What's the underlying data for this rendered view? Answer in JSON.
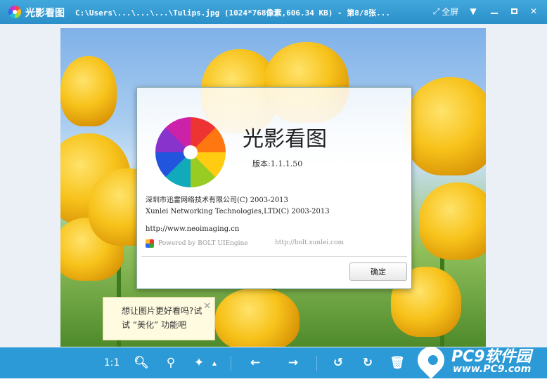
{
  "titlebar": {
    "app_name": "光影看图",
    "file_title": "C:\\Users\\...\\...\\...\\Tulips.jpg (1024*768像素,606.34 KB) - 第8/8张...",
    "fullscreen_label": "全屏"
  },
  "about": {
    "title": "光影看图",
    "version": "版本:1.1.1.50",
    "company_cn": "深圳市迅雷网络技术有限公司(C) 2003-2013",
    "company_en": "Xunlei Networking Technologies,LTD(C) 2003-2013",
    "url": "http://www.neoimaging.cn",
    "powered": "Powered by BOLT UIEngine",
    "bolt_url": "http://bolt.xunlei.com",
    "ok_label": "确定"
  },
  "tip": {
    "line1": "想让图片更好看吗?试",
    "line2": "试 “美化” 功能吧"
  },
  "toolbar": {
    "ratio_label": "1:1"
  },
  "watermark": {
    "brand": "PC9软件园",
    "site": "www.PC9.com"
  },
  "colors": {
    "titlebar": "#2b8fc9",
    "toolbar": "#2b9ad6",
    "tip_bg": "#fffbe0"
  }
}
